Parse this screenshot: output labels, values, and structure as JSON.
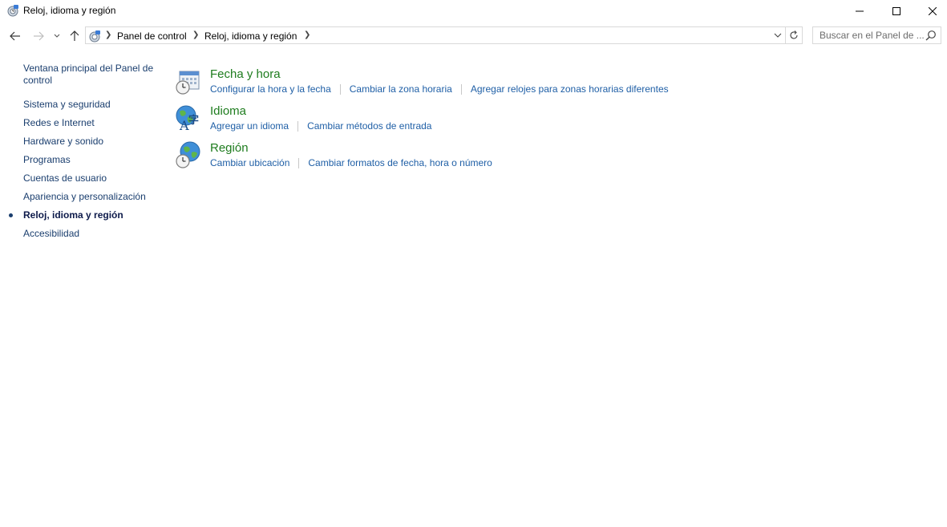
{
  "window": {
    "title": "Reloj, idioma y región"
  },
  "navigation": {
    "breadcrumbs": [
      "Panel de control",
      "Reloj, idioma y región"
    ],
    "search_placeholder": "Buscar en el Panel de ..."
  },
  "sidebar": {
    "items": [
      {
        "label": "Ventana principal del Panel de control",
        "active": false
      },
      {
        "label": "Sistema y seguridad",
        "active": false
      },
      {
        "label": "Redes e Internet",
        "active": false
      },
      {
        "label": "Hardware y sonido",
        "active": false
      },
      {
        "label": "Programas",
        "active": false
      },
      {
        "label": "Cuentas de usuario",
        "active": false
      },
      {
        "label": "Apariencia y personalización",
        "active": false
      },
      {
        "label": "Reloj, idioma y región",
        "active": true
      },
      {
        "label": "Accesibilidad",
        "active": false
      }
    ]
  },
  "sections": [
    {
      "title": "Fecha y hora",
      "icon": "calendar-clock-icon",
      "links": [
        "Configurar la hora y la fecha",
        "Cambiar la zona horaria",
        "Agregar relojes para zonas horarias diferentes"
      ]
    },
    {
      "title": "Idioma",
      "icon": "language-globe-icon",
      "links": [
        "Agregar un idioma",
        "Cambiar métodos de entrada"
      ]
    },
    {
      "title": "Región",
      "icon": "region-globe-clock-icon",
      "links": [
        "Cambiar ubicación",
        "Cambiar formatos de fecha, hora o número"
      ]
    }
  ],
  "colors": {
    "section_title": "#1e7c1e",
    "link": "#1f5fa6",
    "sidebar_link": "#1a3e6e"
  }
}
